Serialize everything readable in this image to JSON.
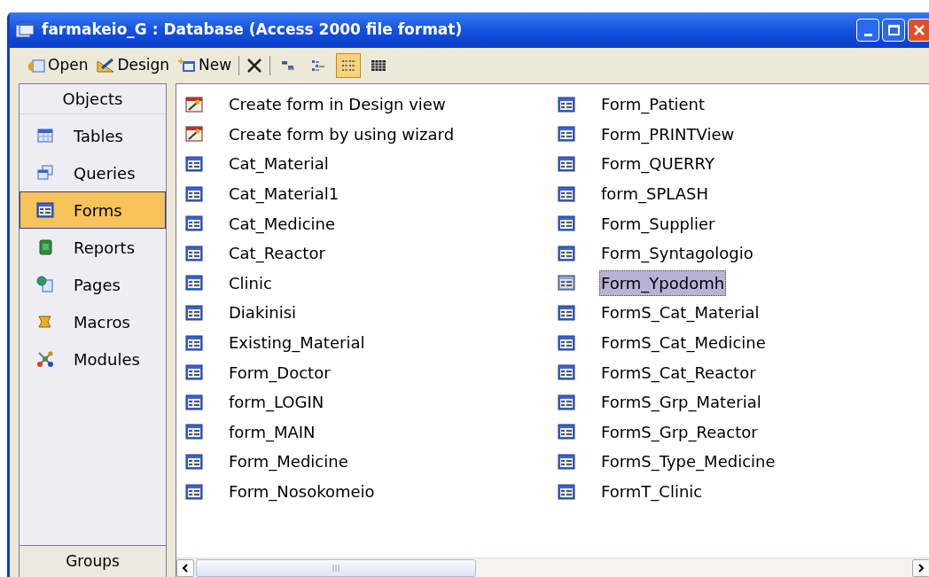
{
  "window": {
    "title": "farmakeio_G : Database (Access 2000 file format)"
  },
  "toolbar": {
    "buttons": [
      {
        "label": "Open",
        "kind": "open"
      },
      {
        "label": "Design",
        "kind": "design"
      },
      {
        "label": "New",
        "kind": "new"
      }
    ],
    "views": [
      {
        "kind": "large",
        "selected": false
      },
      {
        "kind": "small",
        "selected": false
      },
      {
        "kind": "list",
        "selected": true
      },
      {
        "kind": "details",
        "selected": false
      }
    ]
  },
  "sidebar": {
    "header": "Objects",
    "items": [
      {
        "label": "Tables",
        "kind": "tables",
        "selected": false
      },
      {
        "label": "Queries",
        "kind": "queries",
        "selected": false
      },
      {
        "label": "Forms",
        "kind": "forms",
        "selected": true
      },
      {
        "label": "Reports",
        "kind": "reports",
        "selected": false
      },
      {
        "label": "Pages",
        "kind": "pages",
        "selected": false
      },
      {
        "label": "Macros",
        "kind": "macros",
        "selected": false
      },
      {
        "label": "Modules",
        "kind": "modules",
        "selected": false
      }
    ],
    "footer": "Groups"
  },
  "list": {
    "columns": [
      [
        {
          "label": "Create form in Design view",
          "kind": "wizard",
          "selected": false
        },
        {
          "label": "Create form by using wizard",
          "kind": "wizard",
          "selected": false
        },
        {
          "label": "Cat_Material",
          "kind": "form",
          "selected": false
        },
        {
          "label": "Cat_Material1",
          "kind": "form",
          "selected": false
        },
        {
          "label": "Cat_Medicine",
          "kind": "form",
          "selected": false
        },
        {
          "label": "Cat_Reactor",
          "kind": "form",
          "selected": false
        },
        {
          "label": "Clinic",
          "kind": "form",
          "selected": false
        },
        {
          "label": "Diakinisi",
          "kind": "form",
          "selected": false
        },
        {
          "label": "Existing_Material",
          "kind": "form",
          "selected": false
        },
        {
          "label": "Form_Doctor",
          "kind": "form",
          "selected": false
        },
        {
          "label": "form_LOGIN",
          "kind": "form",
          "selected": false
        },
        {
          "label": "form_MAIN",
          "kind": "form",
          "selected": false
        },
        {
          "label": "Form_Medicine",
          "kind": "form",
          "selected": false
        },
        {
          "label": "Form_Nosokomeio",
          "kind": "form",
          "selected": false
        }
      ],
      [
        {
          "label": "Form_Patient",
          "kind": "form",
          "selected": false
        },
        {
          "label": "Form_PRINTView",
          "kind": "form",
          "selected": false
        },
        {
          "label": "Form_QUERRY",
          "kind": "form",
          "selected": false
        },
        {
          "label": "form_SPLASH",
          "kind": "form",
          "selected": false
        },
        {
          "label": "Form_Supplier",
          "kind": "form",
          "selected": false
        },
        {
          "label": "Form_Syntagologio",
          "kind": "form",
          "selected": false
        },
        {
          "label": "Form_Ypodomh",
          "kind": "form",
          "selected": true
        },
        {
          "label": "FormS_Cat_Material",
          "kind": "form",
          "selected": false
        },
        {
          "label": "FormS_Cat_Medicine",
          "kind": "form",
          "selected": false
        },
        {
          "label": "FormS_Cat_Reactor",
          "kind": "form",
          "selected": false
        },
        {
          "label": "FormS_Grp_Material",
          "kind": "form",
          "selected": false
        },
        {
          "label": "FormS_Grp_Reactor",
          "kind": "form",
          "selected": false
        },
        {
          "label": "FormS_Type_Medicine",
          "kind": "form",
          "selected": false
        },
        {
          "label": "FormT_Clinic",
          "kind": "form",
          "selected": false
        }
      ]
    ]
  }
}
